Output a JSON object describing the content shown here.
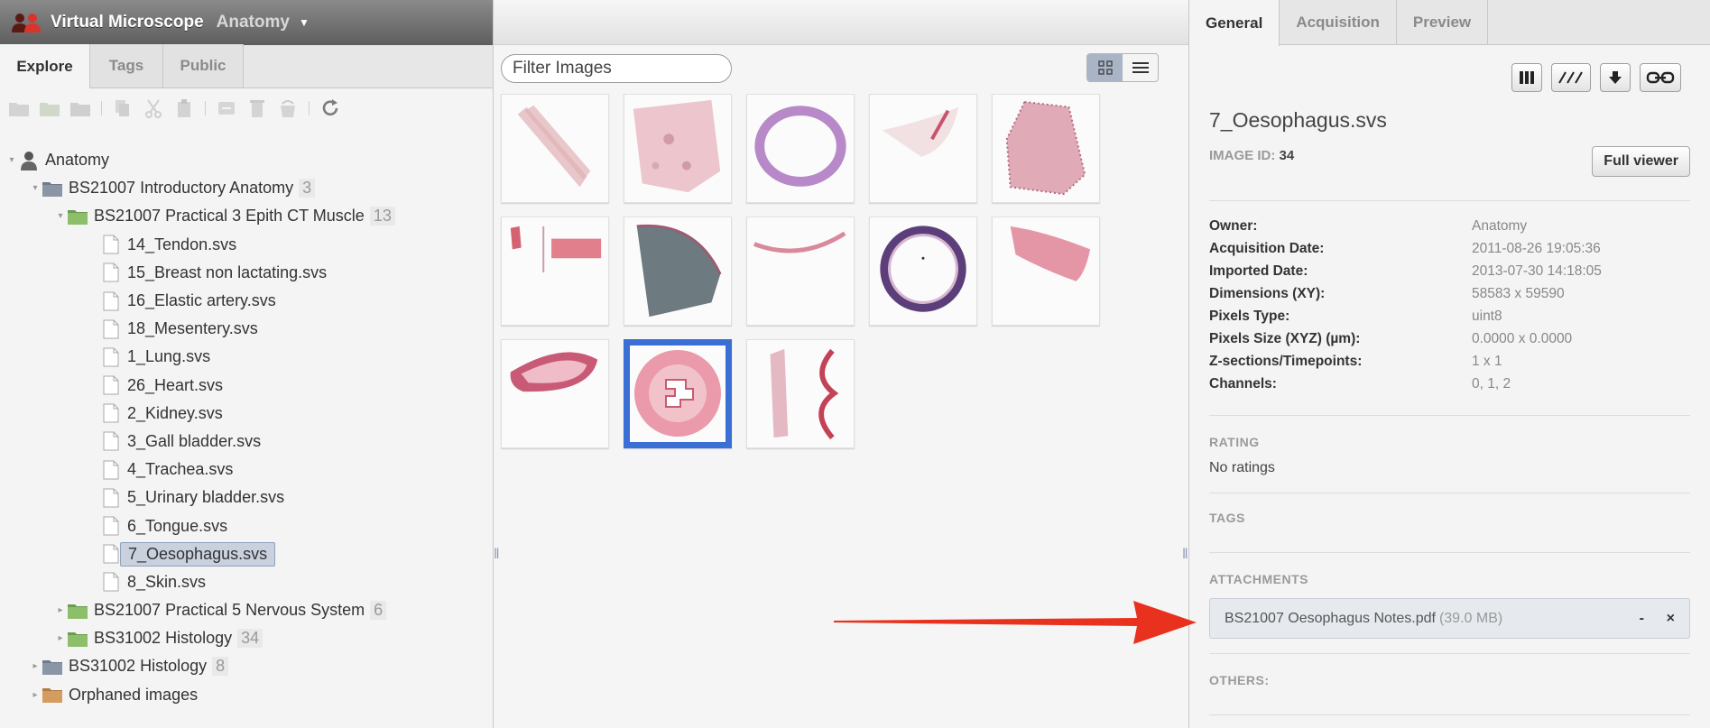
{
  "header": {
    "title": "Virtual Microscope",
    "group": "Anatomy"
  },
  "left_tabs": [
    "Explore",
    "Tags",
    "Public"
  ],
  "tree": [
    {
      "label": "Anatomy",
      "level": 0,
      "type": "user",
      "expanded": true
    },
    {
      "label": "BS21007 Introductory Anatomy",
      "count": "3",
      "level": 1,
      "type": "project",
      "expanded": true
    },
    {
      "label": "BS21007 Practical 3 Epith CT Muscle",
      "count": "13",
      "level": 2,
      "type": "dataset",
      "expanded": true
    },
    {
      "label": "14_Tendon.svs",
      "level": 3,
      "type": "image"
    },
    {
      "label": "15_Breast non lactating.svs",
      "level": 3,
      "type": "image"
    },
    {
      "label": "16_Elastic artery.svs",
      "level": 3,
      "type": "image"
    },
    {
      "label": "18_Mesentery.svs",
      "level": 3,
      "type": "image"
    },
    {
      "label": "1_Lung.svs",
      "level": 3,
      "type": "image"
    },
    {
      "label": "26_Heart.svs",
      "level": 3,
      "type": "image"
    },
    {
      "label": "2_Kidney.svs",
      "level": 3,
      "type": "image"
    },
    {
      "label": "3_Gall bladder.svs",
      "level": 3,
      "type": "image"
    },
    {
      "label": "4_Trachea.svs",
      "level": 3,
      "type": "image"
    },
    {
      "label": "5_Urinary bladder.svs",
      "level": 3,
      "type": "image"
    },
    {
      "label": "6_Tongue.svs",
      "level": 3,
      "type": "image"
    },
    {
      "label": "7_Oesophagus.svs",
      "level": 3,
      "type": "image",
      "selected": true
    },
    {
      "label": "8_Skin.svs",
      "level": 3,
      "type": "image"
    },
    {
      "label": "BS21007 Practical 5 Nervous System",
      "count": "6",
      "level": 2,
      "type": "dataset",
      "expanded": false
    },
    {
      "label": "BS31002 Histology",
      "count": "34",
      "level": 2,
      "type": "dataset",
      "expanded": false
    },
    {
      "label": "BS31002 Histology",
      "count": "8",
      "level": 1,
      "type": "project",
      "expanded": false
    },
    {
      "label": "Orphaned images",
      "level": 1,
      "type": "orphan",
      "expanded": false
    }
  ],
  "center": {
    "filter_placeholder": "Filter Images"
  },
  "right_tabs": [
    "General",
    "Acquisition",
    "Preview"
  ],
  "image": {
    "name": "7_Oesophagus.svs",
    "id_label": "IMAGE ID:",
    "id": "34",
    "full_viewer": "Full viewer"
  },
  "metadata": [
    {
      "key": "Owner:",
      "value": "Anatomy"
    },
    {
      "key": "Acquisition Date:",
      "value": "2011-08-26 19:05:36"
    },
    {
      "key": "Imported Date:",
      "value": "2013-07-30 14:18:05"
    },
    {
      "key": "Dimensions (XY):",
      "value": "58583 x 59590"
    },
    {
      "key": "Pixels Type:",
      "value": "uint8"
    },
    {
      "key": "Pixels Size (XYZ) (µm):",
      "value": "0.0000 x 0.0000"
    },
    {
      "key": "Z-sections/Timepoints:",
      "value": "1 x 1"
    },
    {
      "key": "Channels:",
      "value": "0, 1, 2"
    }
  ],
  "sections": {
    "rating": "RATING",
    "no_ratings": "No ratings",
    "tags": "TAGS",
    "attachments": "ATTACHMENTS",
    "others": "OTHERS:"
  },
  "attachment": {
    "name": "BS21007 Oesophagus Notes.pdf",
    "size": "(39.0 MB)",
    "remove": "-",
    "delete": "×"
  },
  "colors": {
    "selection_blue": "#3a6fd6",
    "arrow_red": "#e8321e",
    "folder_green": "#8dbe6a",
    "project_slate": "#6f7a8a"
  }
}
